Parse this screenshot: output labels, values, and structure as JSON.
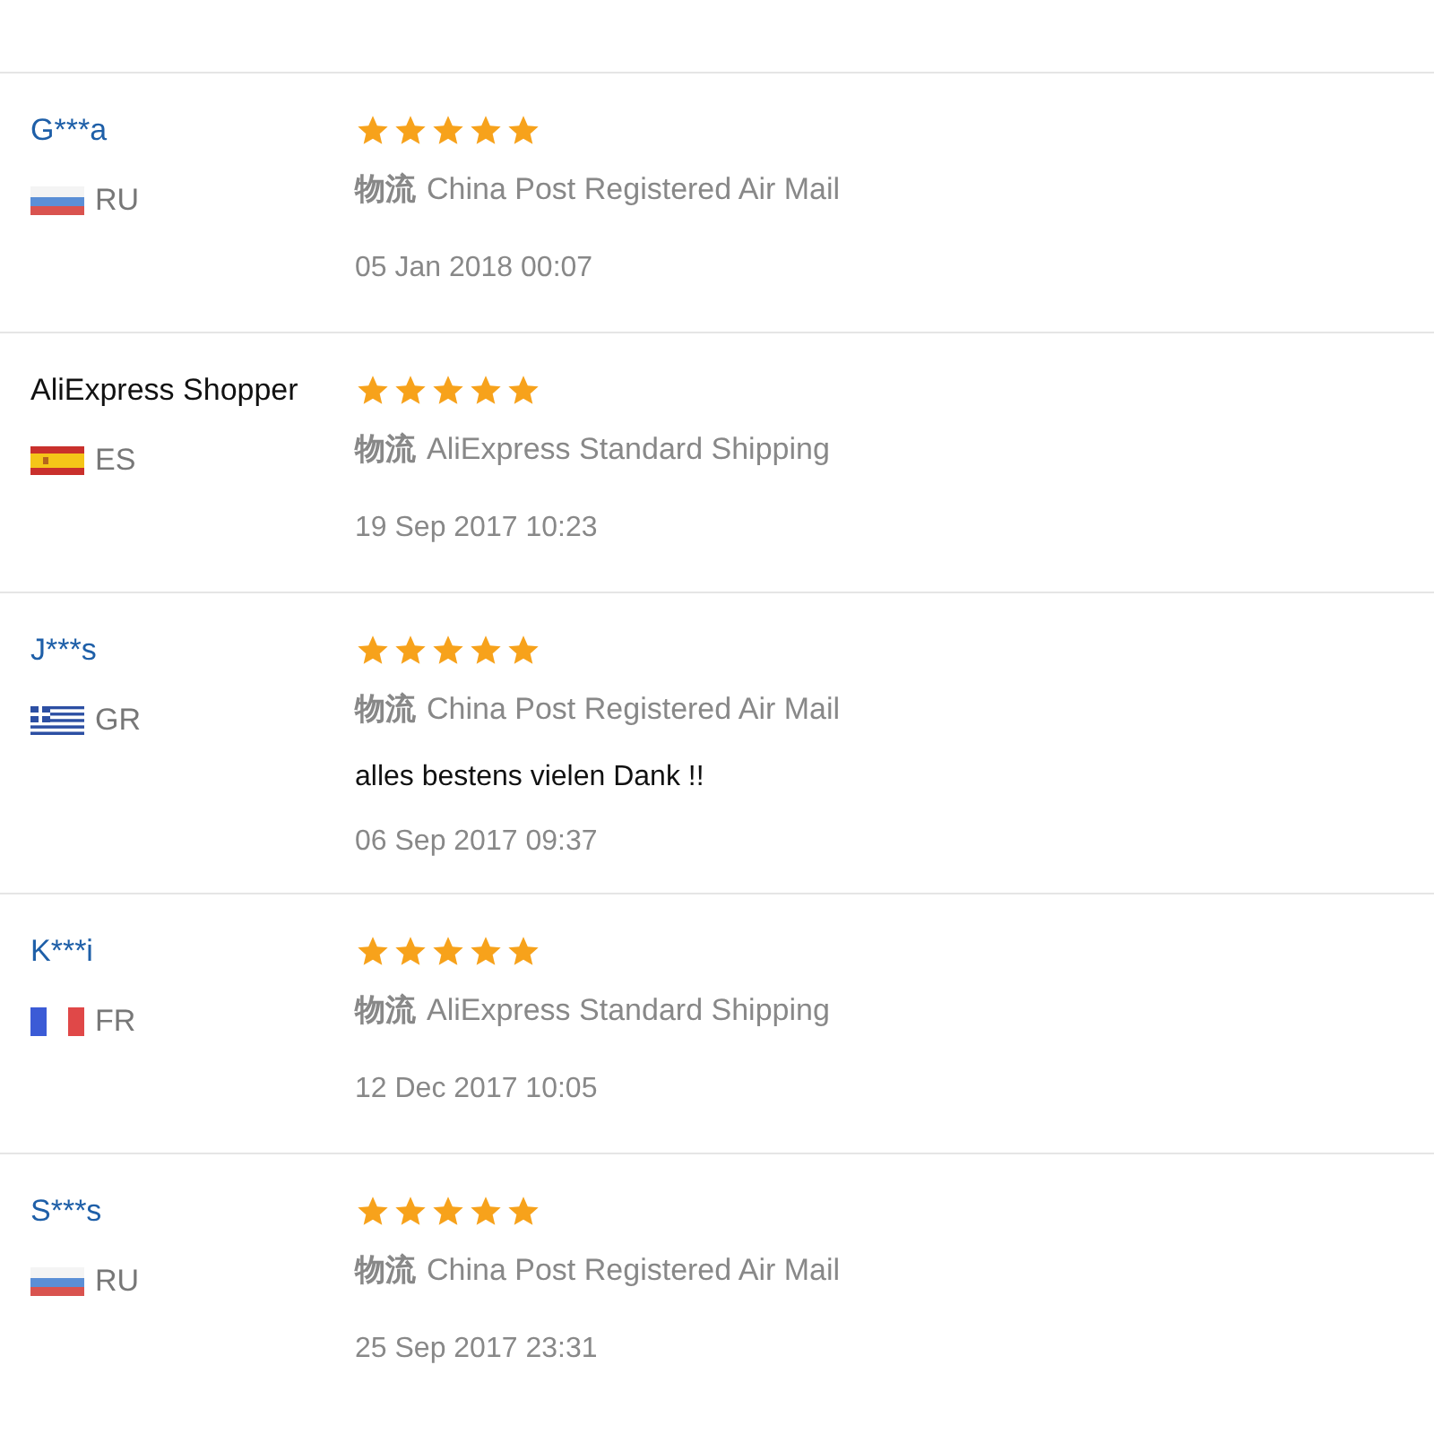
{
  "reviews": [
    {
      "buyer": "G***a",
      "buyer_link": true,
      "flag": {
        "kind": "russia"
      },
      "country": "RU",
      "stars": 5,
      "logistics_label": "物流",
      "logistics": "China Post Registered Air Mail",
      "date": "05 Jan 2018 00:07"
    },
    {
      "buyer": "AliExpress Shopper",
      "buyer_link": false,
      "flag": {
        "kind": "spain"
      },
      "country": "ES",
      "stars": 5,
      "logistics_label": "物流",
      "logistics": "AliExpress Standard Shipping",
      "date": "19 Sep 2017 10:23"
    },
    {
      "buyer": "J***s",
      "buyer_link": true,
      "flag": {
        "kind": "greece"
      },
      "country": "GR",
      "stars": 5,
      "logistics_label": "物流",
      "logistics": "China Post Registered Air Mail",
      "comment": "alles bestens vielen Dank !!",
      "date": "06 Sep 2017 09:37"
    },
    {
      "buyer": "K***i",
      "buyer_link": true,
      "flag": {
        "kind": "france"
      },
      "country": "FR",
      "stars": 5,
      "logistics_label": "物流",
      "logistics": "AliExpress Standard Shipping",
      "date": "12 Dec 2017 10:05"
    },
    {
      "buyer": "S***s",
      "buyer_link": true,
      "flag": {
        "kind": "russia"
      },
      "country": "RU",
      "stars": 5,
      "logistics_label": "物流",
      "logistics": "China Post Registered Air Mail",
      "date": "25 Sep 2017 23:31"
    }
  ]
}
